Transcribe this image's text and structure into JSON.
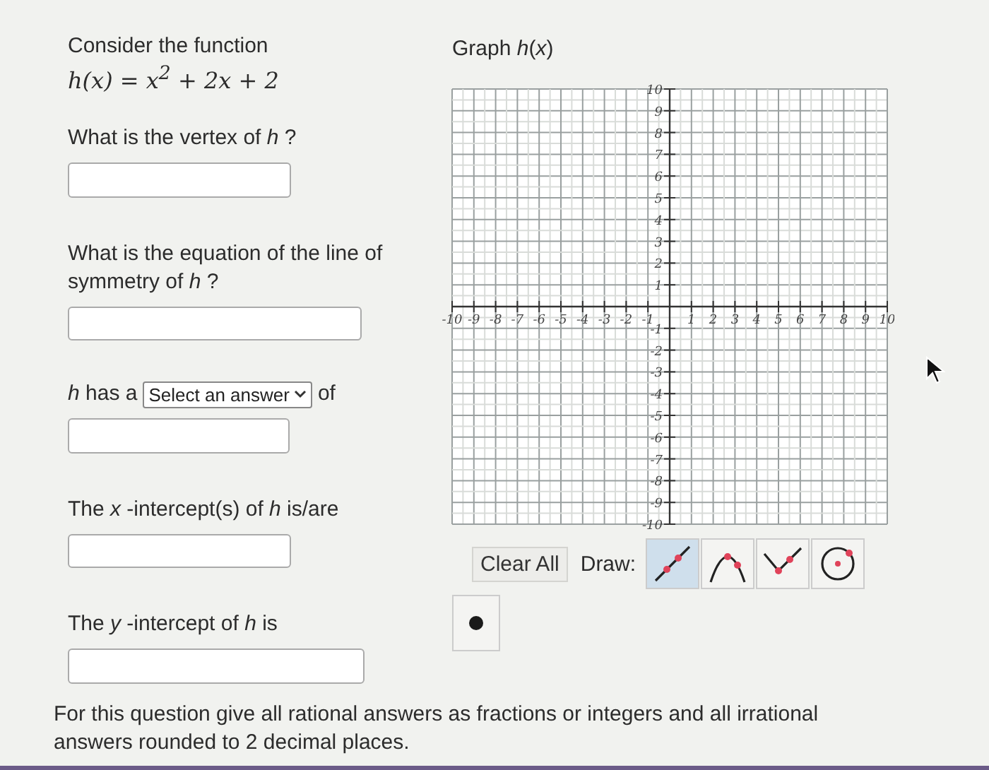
{
  "intro": "Consider the function",
  "formula": "h(x) = x$^{2}$ + 2x + 2",
  "questions": [
    {
      "kind": "text",
      "label": "What is the vertex of *h* ?"
    },
    {
      "kind": "text",
      "label": "What is the equation of the line of symmetry of *h* ?"
    },
    {
      "kind": "select",
      "before": "*h*  has a",
      "select": "Select an answer",
      "after": "of"
    },
    {
      "kind": "text",
      "label": "The *x* -intercept(s) of *h*  is/are"
    },
    {
      "kind": "text",
      "label": "The *y* -intercept of *h*  is"
    }
  ],
  "graph": {
    "title": "Graph *h*(*x*)",
    "x_tick_labels": [
      "-10",
      "-9",
      "-8",
      "-7",
      "-6",
      "-5",
      "-4",
      "-3",
      "-2",
      "-1",
      "1",
      "2",
      "3",
      "4",
      "5",
      "6",
      "7",
      "8",
      "9",
      "10"
    ],
    "y_tick_labels": [
      "10",
      "9",
      "8",
      "7",
      "6",
      "5",
      "4",
      "3",
      "2",
      "1",
      "-1",
      "-2",
      "-3",
      "-4",
      "-5",
      "-6",
      "-7",
      "-8",
      "-9",
      "-10"
    ],
    "clear_button": "Clear All",
    "draw_label": "Draw:",
    "tools": [
      {
        "kind": "line",
        "selected": true
      },
      {
        "kind": "parabola",
        "selected": false
      },
      {
        "kind": "absolute",
        "selected": false
      },
      {
        "kind": "circle",
        "selected": false
      }
    ],
    "point_tool": {
      "kind": "point",
      "selected": false
    }
  },
  "note": "For this question give all rational answers as fractions or integers and all irrational answers rounded to 2 decimal places."
}
